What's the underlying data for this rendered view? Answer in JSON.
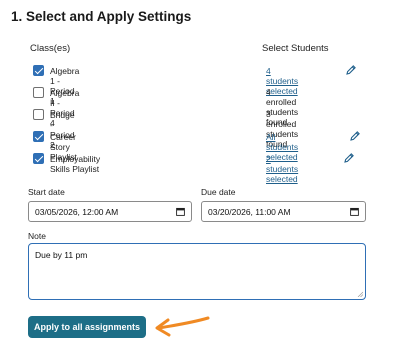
{
  "section_title": "1. Select and Apply Settings",
  "headers": {
    "classes": "Class(es)",
    "students": "Select Students"
  },
  "rows": [
    {
      "label": "Algebra 1 - Period 1",
      "checked": true,
      "students": "4 students selected",
      "students_is_link": true
    },
    {
      "label": "Algebra II - Period 4",
      "checked": false,
      "students": "4 enrolled students found",
      "students_is_link": false
    },
    {
      "label": "Bridge - Period 2",
      "checked": false,
      "students": "3 enrolled students found",
      "students_is_link": false
    },
    {
      "label": "Career Story Playlist",
      "checked": true,
      "students": "All students selected",
      "students_is_link": true
    },
    {
      "label": "Employability Skills Playlist",
      "checked": true,
      "students": "2 students selected",
      "students_is_link": true
    }
  ],
  "start_date": {
    "label": "Start date",
    "value": "03/05/2026, 12:00 AM"
  },
  "due_date": {
    "label": "Due date",
    "value": "03/20/2026, 11:00 AM"
  },
  "note": {
    "label": "Note",
    "value": "Due by 11 pm"
  },
  "apply_button": "Apply to all assignments",
  "colors": {
    "accent": "#2f6fb5",
    "button": "#1d6e87",
    "link": "#1f5f8b",
    "arrow": "#f08a24"
  },
  "icons": {
    "edit": "pencil-icon",
    "calendar": "calendar-icon",
    "annotation": "arrow-left-icon"
  }
}
